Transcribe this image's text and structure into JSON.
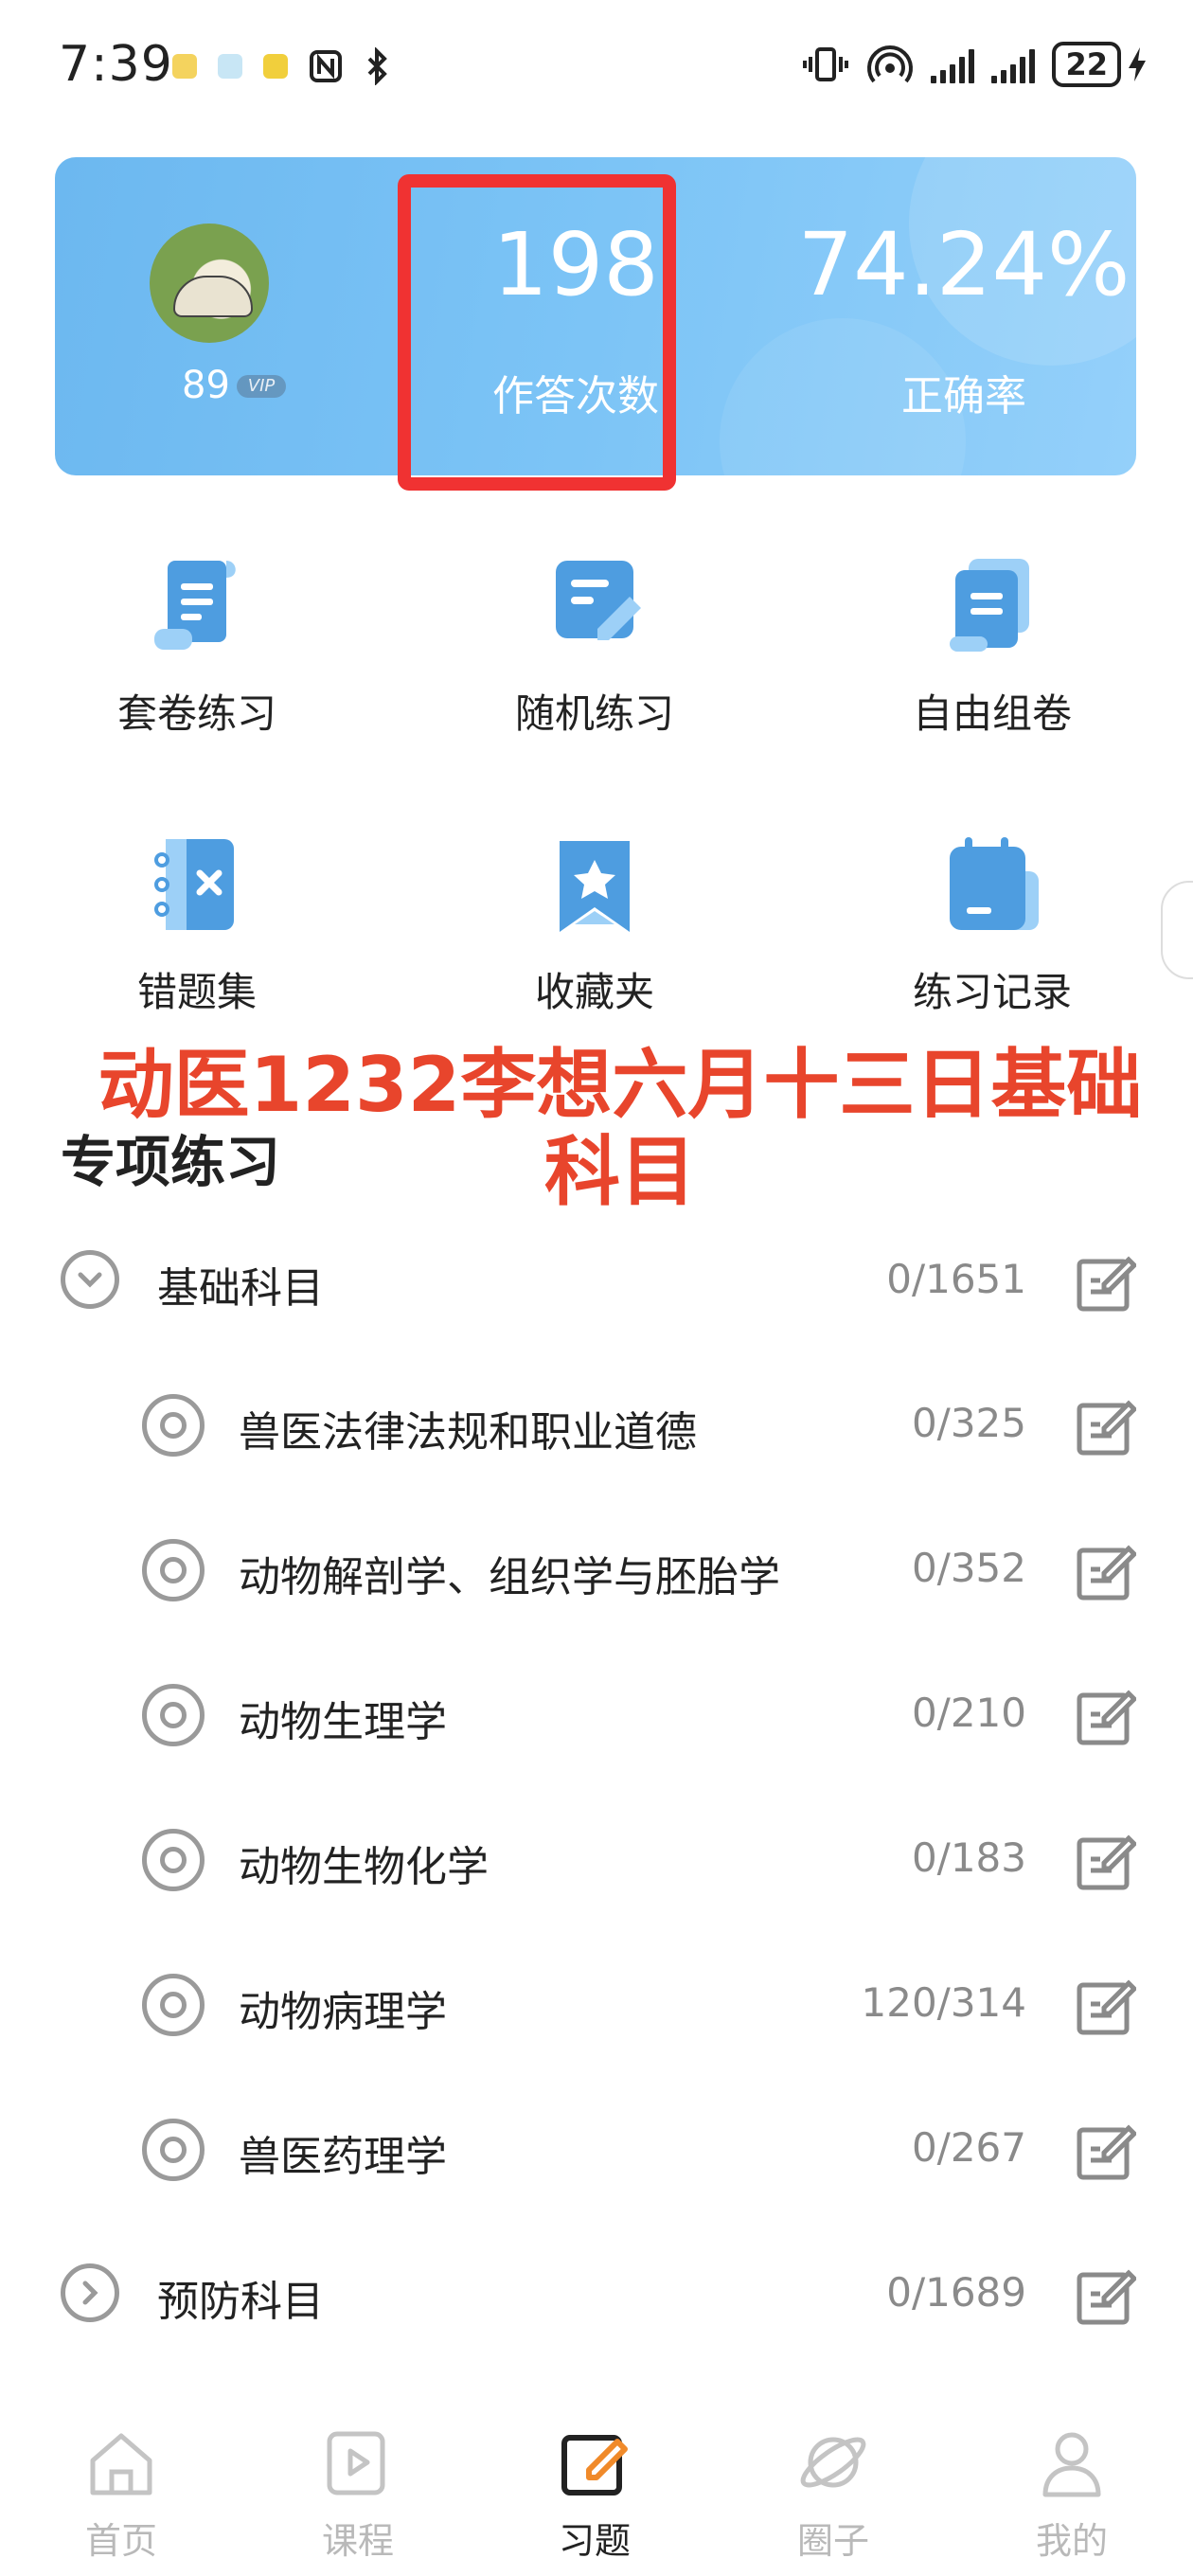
{
  "status_bar": {
    "time": "7:39",
    "battery": "22",
    "signal_label": "1"
  },
  "stats": {
    "level": "89",
    "vip": "VIP",
    "answer_count": "198",
    "answer_count_label": "作答次数",
    "accuracy": "74.24%",
    "accuracy_label": "正确率"
  },
  "practice_grid": [
    {
      "label": "套卷练习",
      "icon": "scroll-doc-icon"
    },
    {
      "label": "随机练习",
      "icon": "doc-pen-icon"
    },
    {
      "label": "自由组卷",
      "icon": "stacked-doc-icon"
    },
    {
      "label": "错题集",
      "icon": "notebook-x-icon"
    },
    {
      "label": "收藏夹",
      "icon": "bookmark-star-icon"
    },
    {
      "label": "练习记录",
      "icon": "calendar-note-icon"
    }
  ],
  "overlay_caption": "动医1232李想六月十三日基础科目",
  "section_title": "专项练习",
  "subjects": [
    {
      "name": "基础科目",
      "count": "0/1651",
      "level": "group",
      "expanded": true
    },
    {
      "name": "兽医法律法规和职业道德",
      "count": "0/325",
      "level": "item"
    },
    {
      "name": "动物解剖学、组织学与胚胎学",
      "count": "0/352",
      "level": "item"
    },
    {
      "name": "动物生理学",
      "count": "0/210",
      "level": "item"
    },
    {
      "name": "动物生物化学",
      "count": "0/183",
      "level": "item"
    },
    {
      "name": "动物病理学",
      "count": "120/314",
      "level": "item"
    },
    {
      "name": "兽医药理学",
      "count": "0/267",
      "level": "item"
    },
    {
      "name": "预防科目",
      "count": "0/1689",
      "level": "group",
      "expanded": false
    }
  ],
  "bottom_nav": [
    {
      "label": "首页",
      "icon": "home-icon",
      "active": false
    },
    {
      "label": "课程",
      "icon": "play-book-icon",
      "active": false
    },
    {
      "label": "习题",
      "icon": "exercise-edit-icon",
      "active": true
    },
    {
      "label": "圈子",
      "icon": "planet-icon",
      "active": false
    },
    {
      "label": "我的",
      "icon": "profile-icon",
      "active": false
    }
  ],
  "colors": {
    "accent": "#5aaee8",
    "card_gradient_start": "#6cb8f0",
    "highlight": "#f03232",
    "overlay_text": "#e8452c",
    "active_tab_icon": "#f08a2a"
  }
}
